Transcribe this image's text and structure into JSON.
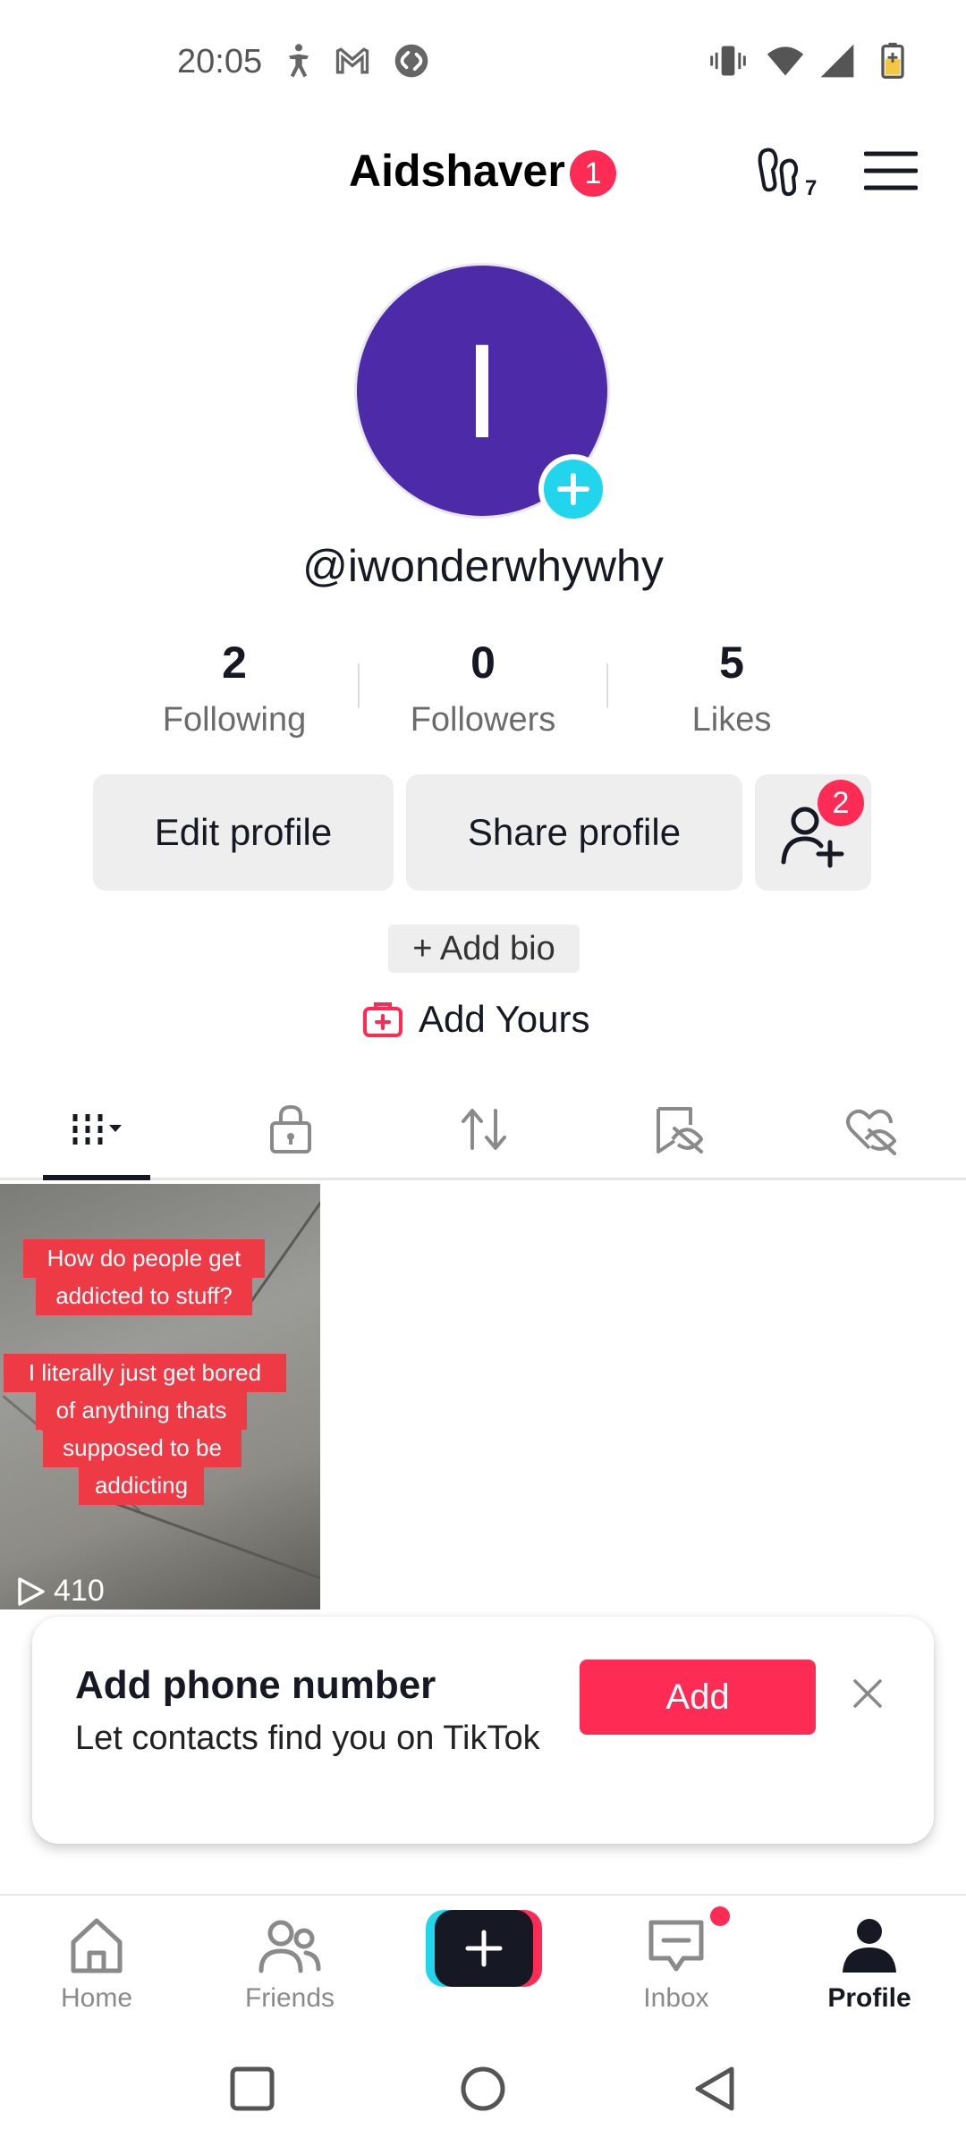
{
  "status_bar": {
    "time": "20:05",
    "left_icons": [
      "accessibility-icon",
      "gmail-icon",
      "shazam-icon"
    ],
    "right_icons": [
      "vibrate-icon",
      "wifi-icon",
      "signal-icon",
      "battery-icon"
    ]
  },
  "header": {
    "title": "Aidshaver",
    "badge": "1",
    "creator_icon": "creator-tools-icon",
    "menu_icon": "menu-icon"
  },
  "profile": {
    "avatar_letter": "I",
    "avatar_color": "#4d2aa8",
    "username": "@iwonderwhywhy",
    "stats": [
      {
        "value": "2",
        "label": "Following"
      },
      {
        "value": "0",
        "label": "Followers"
      },
      {
        "value": "5",
        "label": "Likes"
      }
    ],
    "edit_profile": "Edit profile",
    "share_profile": "Share profile",
    "friends_badge": "2",
    "add_bio": "+ Add bio",
    "add_yours": "Add Yours"
  },
  "tabs": [
    "videos-grid-icon",
    "private-lock-icon",
    "reposts-icon",
    "favorites-hidden-icon",
    "liked-hidden-icon"
  ],
  "video": {
    "caption_lines_1": [
      "How do people get",
      "addicted to stuff?"
    ],
    "caption_lines_2": [
      "I literally just get bored",
      "of anything thats",
      "supposed to be",
      "addicting"
    ],
    "views": "410"
  },
  "popup": {
    "title": "Add phone number",
    "text": "Let contacts find you on TikTok",
    "add_label": "Add"
  },
  "bottom_nav": {
    "home": "Home",
    "friends": "Friends",
    "inbox": "Inbox",
    "profile": "Profile"
  },
  "colors": {
    "accent": "#fe2c55",
    "cyan": "#20d5ec",
    "text": "#161823"
  }
}
